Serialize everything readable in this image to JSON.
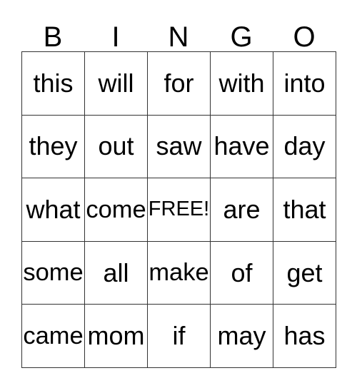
{
  "card": {
    "title": "BINGO",
    "header_letters": [
      "B",
      "I",
      "N",
      "G",
      "O"
    ],
    "grid": [
      [
        "this",
        "will",
        "for",
        "with",
        "into"
      ],
      [
        "they",
        "out",
        "saw",
        "have",
        "day"
      ],
      [
        "what",
        "come",
        "FREE!",
        "are",
        "that"
      ],
      [
        "some",
        "all",
        "make",
        "of",
        "get"
      ],
      [
        "came",
        "mom",
        "if",
        "may",
        "has"
      ]
    ],
    "free_space": {
      "row": 2,
      "col": 2,
      "label": "FREE!"
    },
    "colors": {
      "background": "#ffffff",
      "text": "#000000",
      "border": "#333333"
    }
  }
}
